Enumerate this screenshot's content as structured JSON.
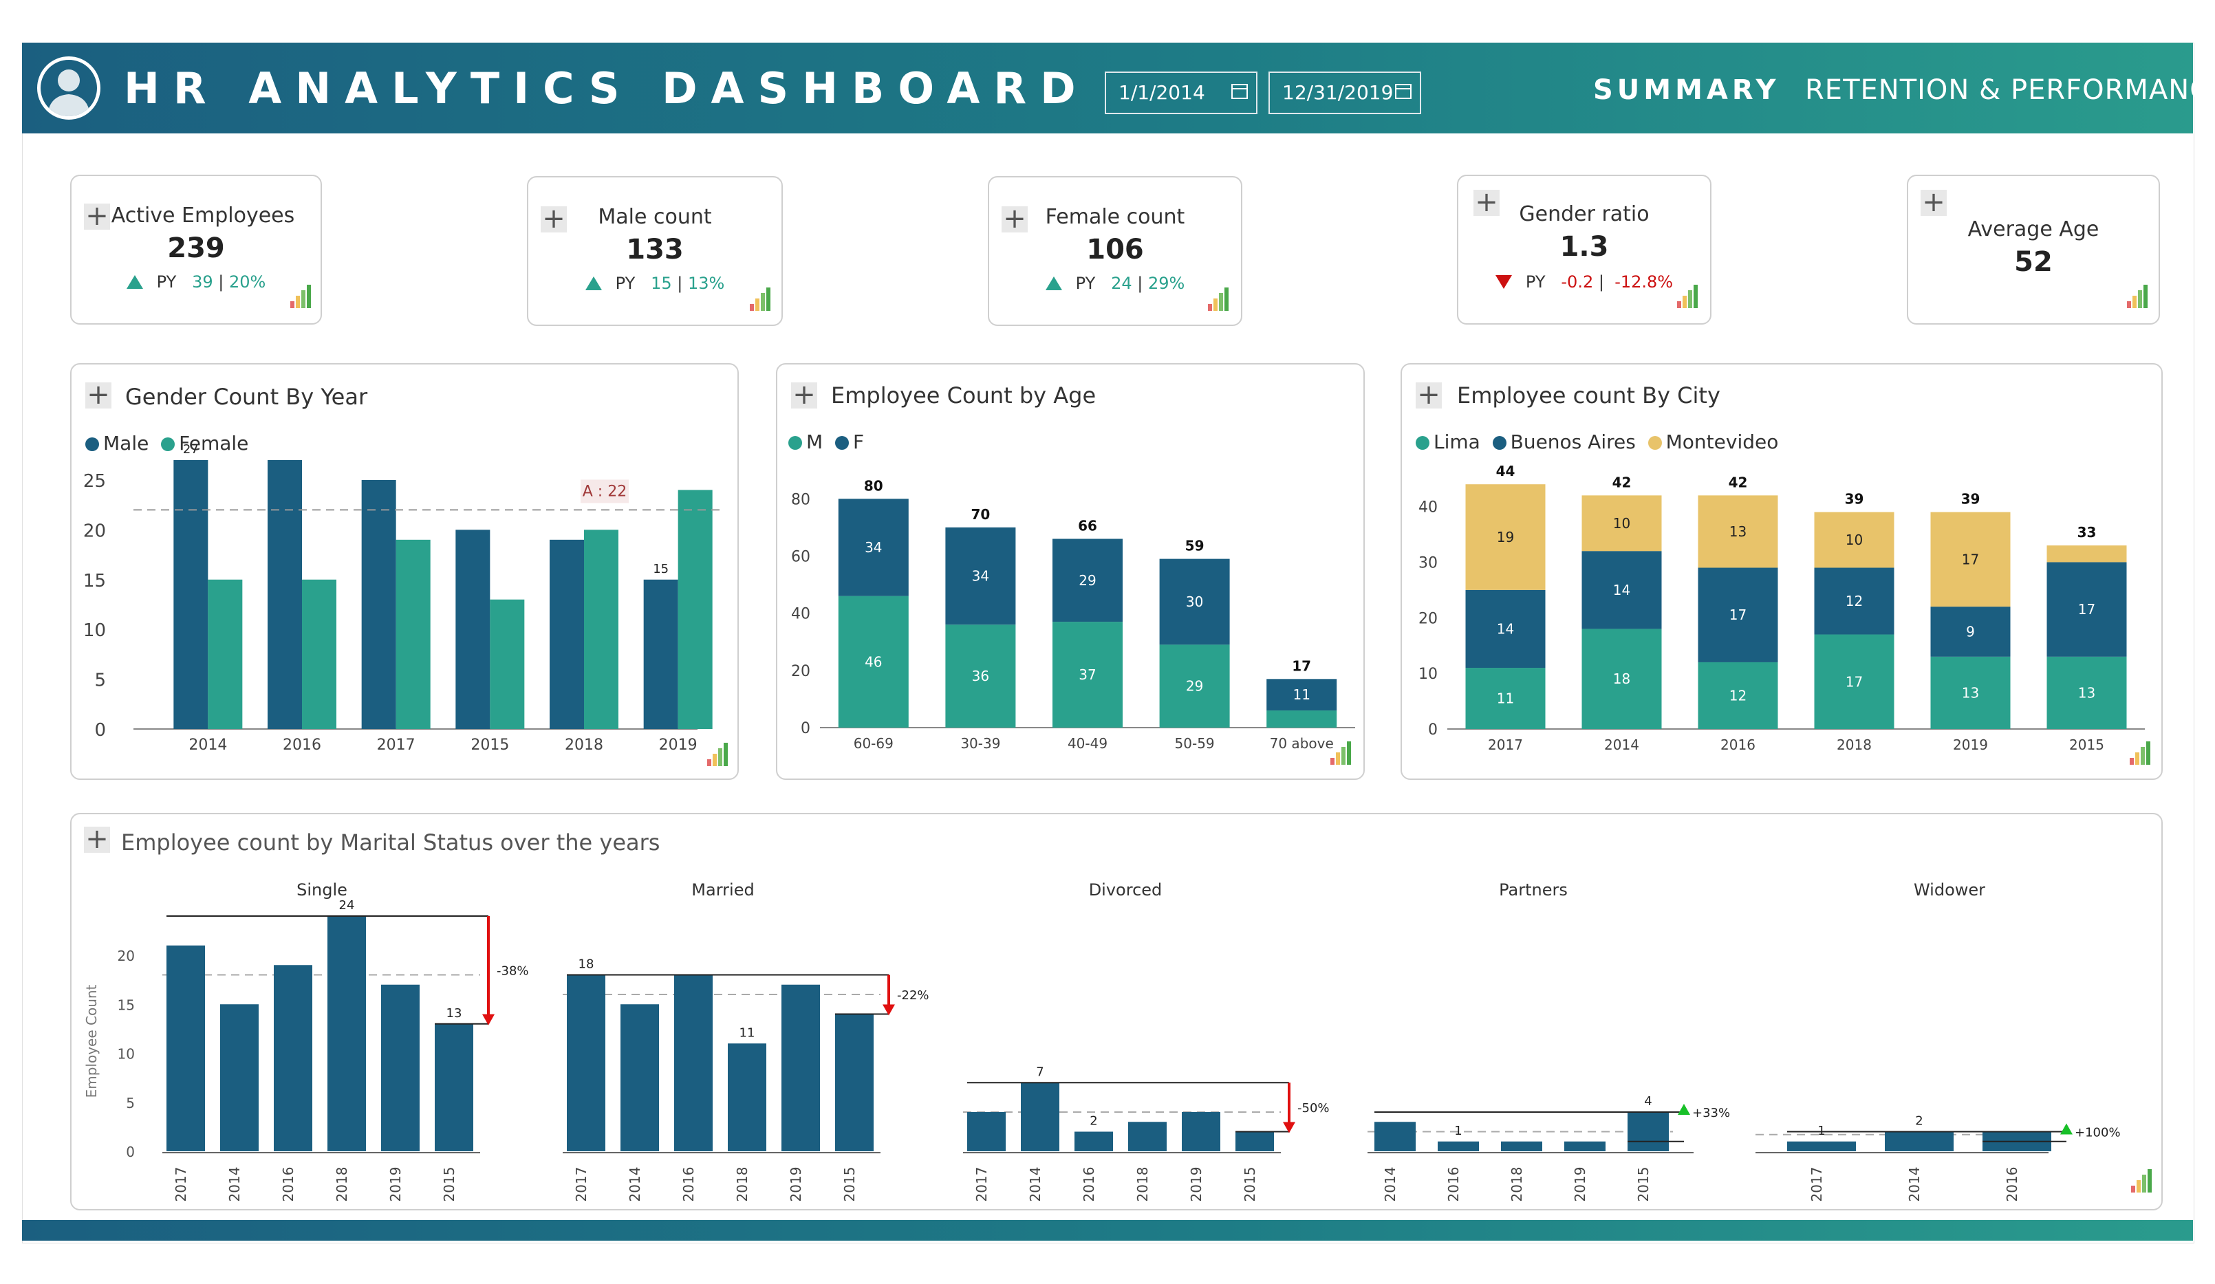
{
  "header": {
    "title": "HR ANALYTICS DASHBOARD",
    "date_from": "1/1/2014",
    "date_to": "12/31/2019",
    "nav_summary": "SUMMARY",
    "nav_retention": "RETENTION & PERFORMANCE"
  },
  "colors": {
    "male": "#1b5e80",
    "female": "#2aa18d",
    "lima": "#2aa18d",
    "buenos_aires": "#1b5e80",
    "montevideo": "#e8c36a",
    "up": "#2aa18d",
    "down": "#cc1111"
  },
  "kpis": [
    {
      "label": "Active Employees",
      "value": "239",
      "trend": "up",
      "py_label": "PY",
      "py_value": "39",
      "py_pct": "20%"
    },
    {
      "label": "Male count",
      "value": "133",
      "trend": "up",
      "py_label": "PY",
      "py_value": "15",
      "py_pct": "13%"
    },
    {
      "label": "Female count",
      "value": "106",
      "trend": "up",
      "py_label": "PY",
      "py_value": "24",
      "py_pct": "29%"
    },
    {
      "label": "Gender ratio",
      "value": "1.3",
      "trend": "down",
      "py_label": "PY",
      "py_value": "-0.2",
      "py_pct": "-12.8%"
    },
    {
      "label": "Average Age",
      "value": "52"
    }
  ],
  "gender_chart": {
    "title": "Gender Count By Year",
    "legend": [
      "Male",
      "Female"
    ],
    "average_label": "A : 22",
    "chart_data": {
      "type": "bar",
      "categories": [
        "2014",
        "2016",
        "2017",
        "2015",
        "2018",
        "2019"
      ],
      "series": [
        {
          "name": "Male",
          "values": [
            27,
            27,
            25,
            20,
            19,
            15
          ]
        },
        {
          "name": "Female",
          "values": [
            15,
            15,
            19,
            13,
            20,
            24
          ]
        }
      ],
      "average": 22,
      "ylim": [
        0,
        29
      ],
      "yticks": [
        0,
        5,
        10,
        15,
        20,
        25
      ],
      "labels": [
        {
          "category": "2014",
          "series": "Male",
          "text": "27"
        },
        {
          "category": "2019",
          "series": "Male",
          "text": "15"
        }
      ]
    }
  },
  "age_chart": {
    "title": "Employee Count by Age",
    "legend": [
      "M",
      "F"
    ],
    "chart_data": {
      "type": "bar",
      "stacked": true,
      "categories": [
        "60-69",
        "30-39",
        "40-49",
        "50-59",
        "70 above"
      ],
      "series": [
        {
          "name": "F",
          "values": [
            46,
            36,
            37,
            29,
            6
          ]
        },
        {
          "name": "M",
          "values": [
            34,
            34,
            29,
            30,
            11
          ]
        }
      ],
      "totals": [
        80,
        70,
        66,
        59,
        17
      ],
      "segment_labels": [
        [
          "46",
          "34"
        ],
        [
          "36",
          "34"
        ],
        [
          "37",
          "29"
        ],
        [
          "29",
          "30"
        ],
        [
          "",
          "11"
        ]
      ],
      "ylim": [
        0,
        88
      ],
      "yticks": [
        0,
        20,
        40,
        60,
        80
      ]
    }
  },
  "city_chart": {
    "title": "Employee count By City",
    "legend": [
      "Lima",
      "Buenos Aires",
      "Montevideo"
    ],
    "chart_data": {
      "type": "bar",
      "stacked": true,
      "categories": [
        "2017",
        "2014",
        "2016",
        "2018",
        "2019",
        "2015"
      ],
      "series": [
        {
          "name": "Lima",
          "values": [
            11,
            18,
            12,
            17,
            13,
            13
          ]
        },
        {
          "name": "Buenos Aires",
          "values": [
            14,
            14,
            17,
            12,
            9,
            17
          ]
        },
        {
          "name": "Montevideo",
          "values": [
            19,
            10,
            13,
            10,
            17,
            3
          ]
        }
      ],
      "totals": [
        44,
        42,
        42,
        39,
        39,
        33
      ],
      "segment_labels": [
        [
          "11",
          "14",
          "19"
        ],
        [
          "18",
          "14",
          "10"
        ],
        [
          "12",
          "17",
          "13"
        ],
        [
          "17",
          "12",
          "10"
        ],
        [
          "13",
          "9",
          "17"
        ],
        [
          "13",
          "17",
          ""
        ]
      ],
      "ylim": [
        0,
        46
      ],
      "yticks": [
        0,
        10,
        20,
        30,
        40
      ]
    }
  },
  "marital_chart": {
    "title": "Employee count by Marital Status over the years",
    "ylabel": "Employee Count",
    "yticks": [
      0,
      5,
      10,
      15,
      20
    ],
    "chart_data": [
      {
        "type": "bar",
        "title": "Single",
        "categories": [
          "2017",
          "2014",
          "2016",
          "2018",
          "2019",
          "2015"
        ],
        "values": [
          21,
          15,
          19,
          24,
          17,
          13
        ],
        "labels": {
          "3": "24",
          "5": "13"
        },
        "average": 18,
        "change": "-38%",
        "direction": "down"
      },
      {
        "type": "bar",
        "title": "Married",
        "categories": [
          "2017",
          "2014",
          "2016",
          "2018",
          "2019",
          "2015"
        ],
        "values": [
          18,
          15,
          18,
          11,
          17,
          14
        ],
        "labels": {
          "0": "18",
          "3": "11"
        },
        "average": 16,
        "change": "-22%",
        "direction": "down"
      },
      {
        "type": "bar",
        "title": "Divorced",
        "categories": [
          "2017",
          "2014",
          "2016",
          "2018",
          "2019",
          "2015"
        ],
        "values": [
          4,
          7,
          2,
          3,
          4,
          2
        ],
        "labels": {
          "1": "7",
          "2": "2"
        },
        "average": 4,
        "change": "-50%",
        "direction": "down"
      },
      {
        "type": "bar",
        "title": "Partners",
        "categories": [
          "2014",
          "2016",
          "2018",
          "2019",
          "2015"
        ],
        "values": [
          3,
          1,
          1,
          1,
          4
        ],
        "labels": {
          "1": "1",
          "4": "4"
        },
        "average": 2,
        "change": "+33%",
        "direction": "up"
      },
      {
        "type": "bar",
        "title": "Widower",
        "categories": [
          "2017",
          "2014",
          "2016"
        ],
        "values": [
          1,
          2,
          2
        ],
        "labels": {
          "0": "1",
          "1": "2"
        },
        "average": 1.7,
        "change": "+100%",
        "direction": "up"
      }
    ]
  }
}
